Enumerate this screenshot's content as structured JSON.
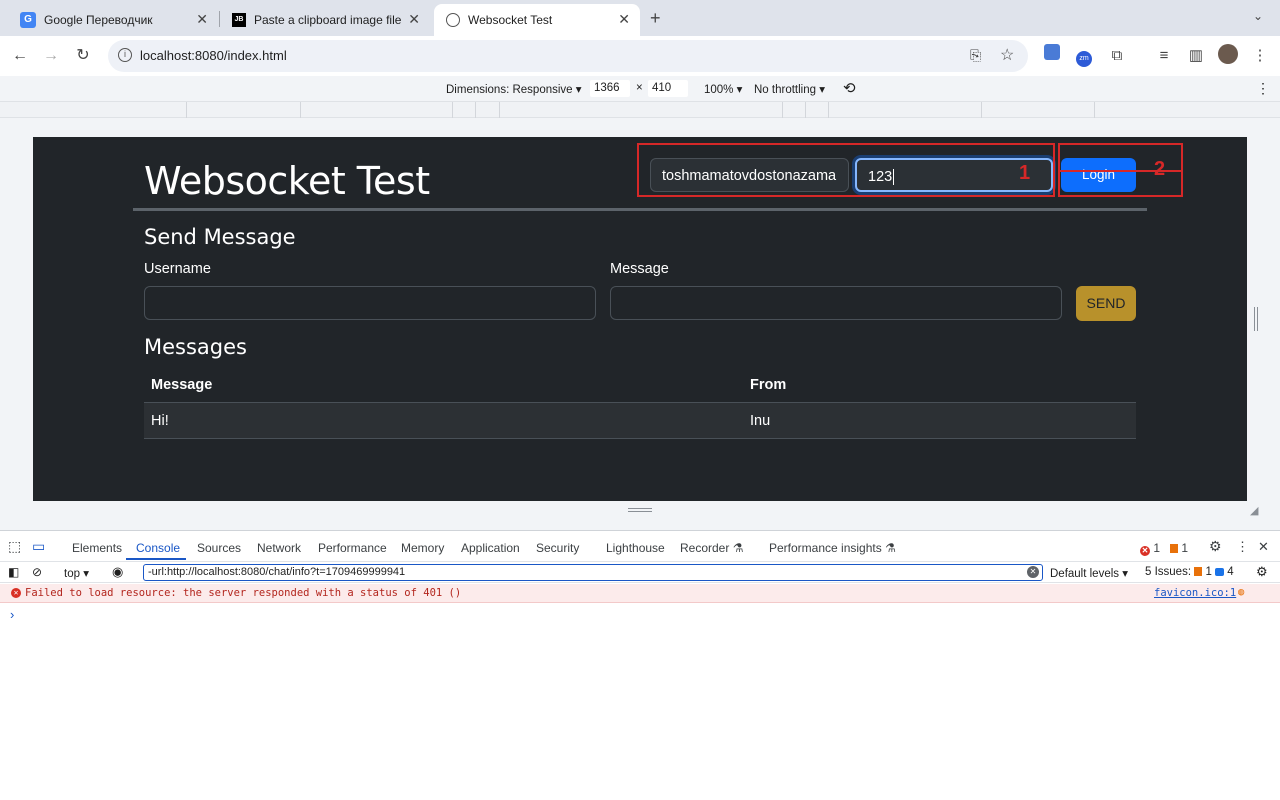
{
  "browser": {
    "tabs": [
      {
        "title": "Google Переводчик",
        "icon": "google-translate-icon"
      },
      {
        "title": "Paste a clipboard image file in",
        "icon": "jetbrains-icon"
      },
      {
        "title": "Websocket Test",
        "icon": "globe-icon"
      }
    ],
    "close_glyph": "✕",
    "new_tab_glyph": "+",
    "url": "localhost:8080/index.html"
  },
  "device_toolbar": {
    "dimensions_label": "Dimensions: Responsive",
    "width": "1366",
    "times": "×",
    "height": "410",
    "zoom": "100%",
    "throttling": "No throttling"
  },
  "page": {
    "title": "Websocket Test",
    "login": {
      "username_value": "toshmamatovdostonazama",
      "password_value": "123",
      "button": "Login"
    },
    "annotations": [
      "1",
      "2"
    ],
    "send_section": {
      "heading": "Send Message",
      "username_label": "Username",
      "message_label": "Message",
      "send_button": "SEND"
    },
    "messages_section": {
      "heading": "Messages",
      "columns": [
        "Message",
        "From"
      ],
      "rows": [
        {
          "message": "Hi!",
          "from": "Inu"
        }
      ]
    }
  },
  "devtools": {
    "tabs": [
      "Elements",
      "Console",
      "Sources",
      "Network",
      "Performance",
      "Memory",
      "Application",
      "Security",
      "Lighthouse",
      "Recorder",
      "Performance insights"
    ],
    "active_tab": "Console",
    "error_count": "1",
    "warning_count": "1",
    "context": "top",
    "filter_value": "-url:http://localhost:8080/chat/info?t=1709469999941",
    "levels": "Default levels",
    "issues_label": "5 Issues:",
    "issues_warn": "1",
    "issues_info": "4",
    "console_messages": [
      {
        "level": "error",
        "text": "Failed to load resource: the server responded with a status of 401 ()",
        "source": "favicon.ico:1"
      }
    ],
    "prompt_glyph": "›"
  },
  "colors": {
    "page_bg": "#212529",
    "primary": "#0d6efd",
    "send_button": "#b8912b",
    "annotation": "#d62828",
    "devtools_accent": "#1a57c6"
  }
}
